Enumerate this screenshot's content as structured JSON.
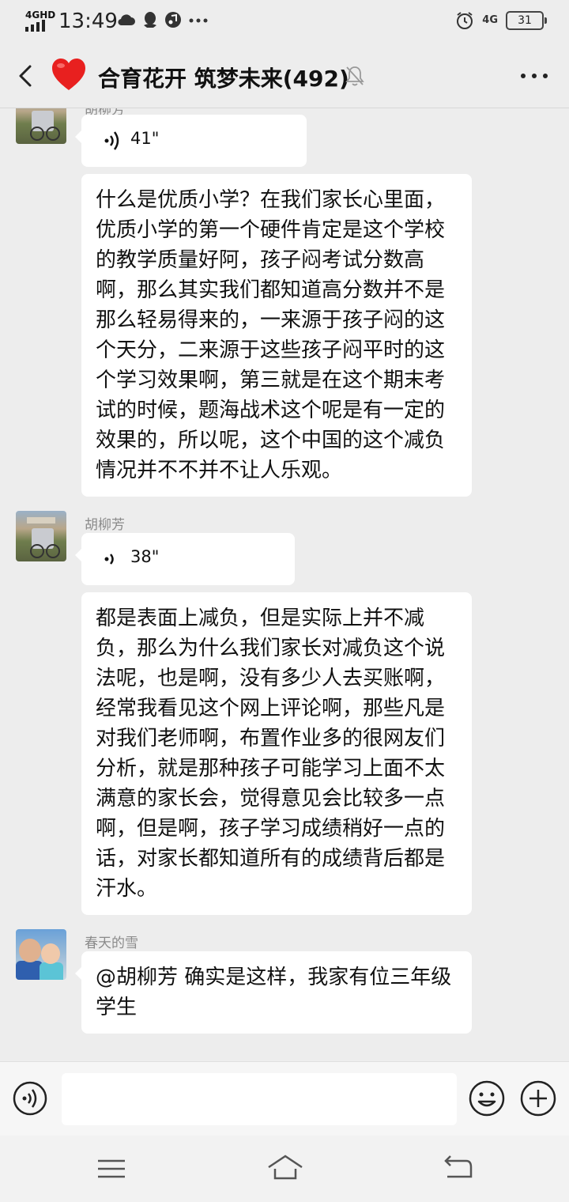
{
  "status_bar": {
    "network_label": "4GHD",
    "time": "13:49",
    "net_right": "4G",
    "battery": "31"
  },
  "header": {
    "title": "合育花开 筑梦未来(492)",
    "heart_color": "#e8201f"
  },
  "messages": [
    {
      "type": "voice",
      "sender": "胡柳芳",
      "duration": "41\""
    },
    {
      "type": "text",
      "sender": "胡柳芳",
      "text": "什么是优质小学？在我们家长心里面，优质小学的第一个硬件肯定是这个学校的教学质量好阿，孩子闷考试分数高啊，那么其实我们都知道高分数并不是那么轻易得来的，一来源于孩子闷的这个天分，二来源于这些孩子闷平时的这个学习效果啊，第三就是在这个期末考试的时候，题海战术这个呢是有一定的效果的，所以呢，这个中国的这个减负情况并不不并不让人乐观。"
    },
    {
      "type": "voice",
      "sender": "胡柳芳",
      "duration": "38\""
    },
    {
      "type": "text",
      "sender": "胡柳芳",
      "text": "都是表面上减负，但是实际上并不减负，那么为什么我们家长对减负这个说法呢，也是啊，没有多少人去买账啊，经常我看见这个网上评论啊，那些凡是对我们老师啊，布置作业多的很网友们分析，就是那种孩子可能学习上面不太满意的家长会，觉得意见会比较多一点啊，但是啊，孩子学习成绩稍好一点的话，对家长都知道所有的成绩背后都是汗水。"
    },
    {
      "type": "text",
      "sender": "春天的雪",
      "text": "@胡柳芳  确实是这样，我家有位三年级学生"
    }
  ],
  "input": {
    "value": "",
    "placeholder": ""
  },
  "colors": {
    "background": "#ededed",
    "bubble": "#ffffff"
  }
}
